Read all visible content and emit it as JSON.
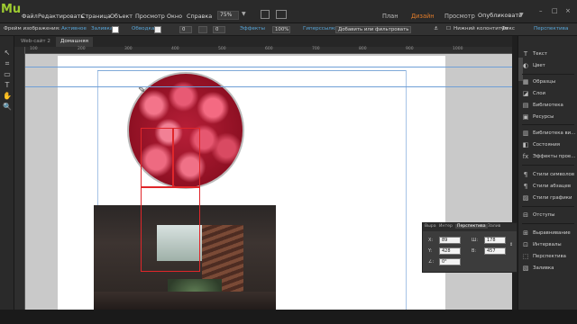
{
  "app": {
    "logo": "Mu"
  },
  "menu": [
    "Файл",
    "Редактировать",
    "Страница",
    "Объект",
    "Просмотр",
    "Окно",
    "Справка"
  ],
  "zoom": {
    "value": "75%"
  },
  "modes": {
    "plan": "План",
    "design": "Дизайн",
    "preview": "Просмотр",
    "publish": "Опубликовать"
  },
  "window": {
    "minimize": "–",
    "maximize": "□",
    "close": "×"
  },
  "controlbar": {
    "frame_label": "Фрейм изображения:",
    "state": "Активное",
    "fill": "Заливка",
    "stroke": "Обводка",
    "stroke_value": "0",
    "effects": "Эффекты",
    "opacity": "100%",
    "hyperlinks": "Гиперссылки",
    "add_filter": "Добавить или фильтровать",
    "footer": "Нижний колонтитул",
    "fix": "Фикс",
    "perspective": "Перспектива"
  },
  "doctabs": {
    "site": "Web-сайт 2",
    "page": "Домашняя"
  },
  "ruler": {
    "ticks": [
      "100",
      "200",
      "300",
      "400",
      "500",
      "600",
      "700",
      "800",
      "900",
      "1000"
    ]
  },
  "float_panel": {
    "tabs": [
      "Выра",
      "Интер",
      "Перспектива",
      "Залив"
    ],
    "x_label": "X:",
    "x": "89",
    "y_label": "Y:",
    "y": "428",
    "w_label": "Ш:",
    "w": "178",
    "h_label": "В:",
    "h": "457",
    "rot_label": "∠:",
    "rot": "0°"
  },
  "right_panel": {
    "items": [
      {
        "icon": "T",
        "label": "Текст"
      },
      {
        "icon": "◐",
        "label": "Цвет"
      },
      {
        "icon": "▦",
        "label": "Образцы"
      },
      {
        "icon": "◪",
        "label": "Слои"
      },
      {
        "icon": "▤",
        "label": "Библиотека"
      },
      {
        "icon": "▣",
        "label": "Ресурсы"
      },
      {
        "icon": "▥",
        "label": "Библиотека ви..."
      },
      {
        "icon": "◧",
        "label": "Состояния"
      },
      {
        "icon": "fx",
        "label": "Эффекты прое..."
      },
      {
        "icon": "¶",
        "label": "Стили символов"
      },
      {
        "icon": "¶",
        "label": "Стили абзацев"
      },
      {
        "icon": "▨",
        "label": "Стили графики"
      },
      {
        "icon": "⊟",
        "label": "Отступы"
      },
      {
        "icon": "⊞",
        "label": "Выравнивание"
      },
      {
        "icon": "⊡",
        "label": "Интервалы"
      },
      {
        "icon": "⬚",
        "label": "Перспектива"
      },
      {
        "icon": "▧",
        "label": "Заливка"
      }
    ]
  }
}
